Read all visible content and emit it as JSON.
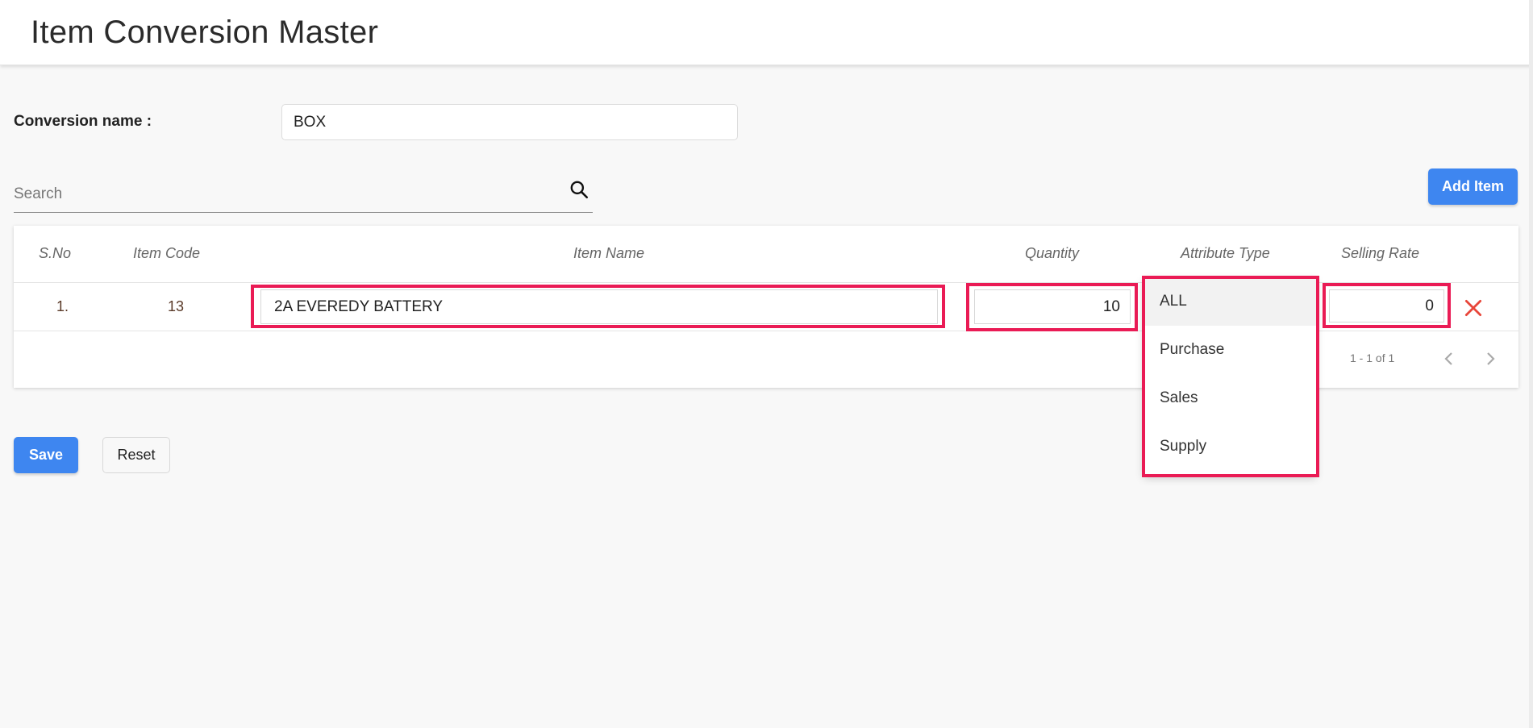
{
  "header": {
    "title": "Item Conversion Master"
  },
  "form": {
    "conversion_label": "Conversion name :",
    "conversion_value": "BOX",
    "search_placeholder": "Search",
    "add_item_label": "Add Item"
  },
  "table": {
    "columns": [
      "S.No",
      "Item Code",
      "Item Name",
      "Quantity",
      "Attribute Type",
      "Selling Rate"
    ],
    "rows": [
      {
        "sno": "1.",
        "item_code": "13",
        "item_name": "2A EVEREDY BATTERY",
        "quantity": "10",
        "attribute_type": "ALL",
        "selling_rate": "0"
      }
    ],
    "pagination": "1 - 1 of 1"
  },
  "dropdown": {
    "options": [
      "ALL",
      "Purchase",
      "Sales",
      "Supply"
    ],
    "selected": "ALL"
  },
  "actions": {
    "save_label": "Save",
    "reset_label": "Reset"
  },
  "colors": {
    "primary": "#3e86f0",
    "highlight": "#ea1b55",
    "delete": "#e8463a"
  }
}
